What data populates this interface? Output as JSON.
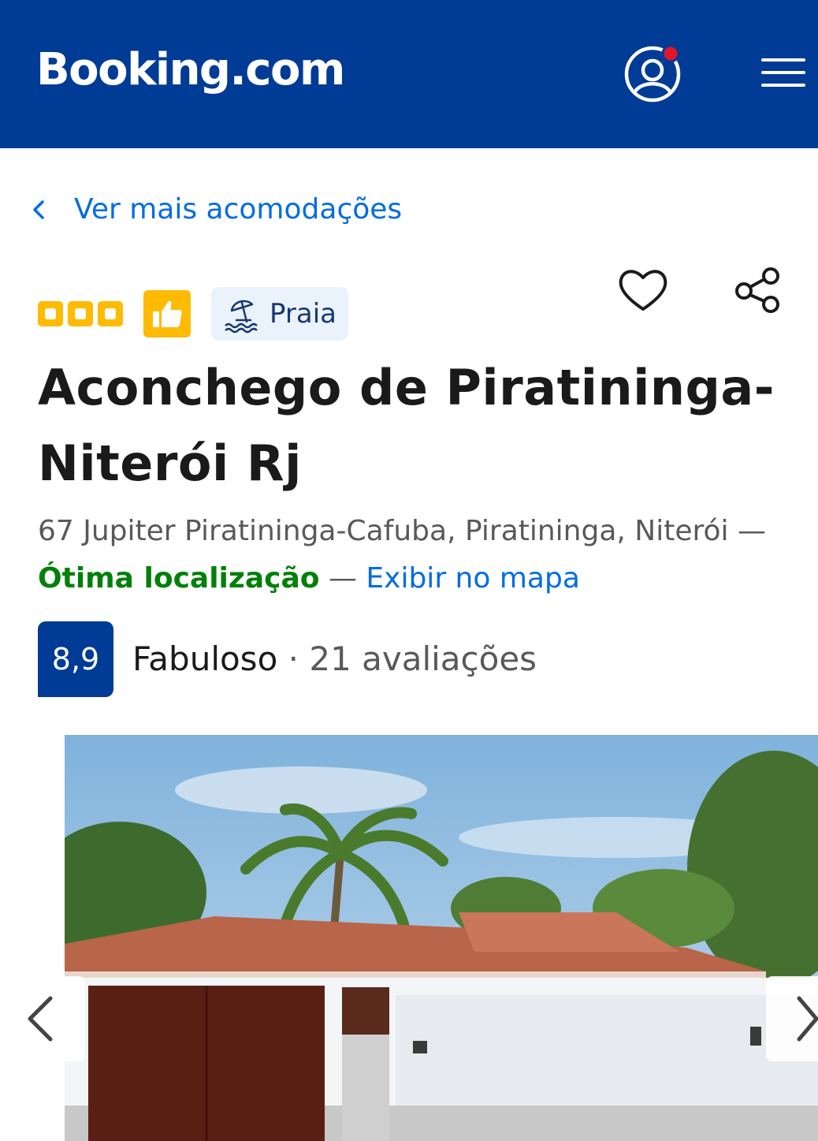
{
  "header": {
    "logo": "Booking.com",
    "account_icon": "account-icon",
    "menu_icon": "hamburger-menu-icon",
    "brand_color": "#003b95",
    "notification_color": "#e0162b"
  },
  "back_link": {
    "label": "Ver mais acomodações",
    "icon": "chevron-left-icon"
  },
  "property": {
    "rating_squares": 3,
    "preferred_icon": "thumbs-up-icon",
    "tag": {
      "label": "Praia",
      "icon": "beach-umbrella-icon"
    },
    "favorite_icon": "heart-icon",
    "share_icon": "share-icon",
    "name": "Aconchego de Piratininga-Niterói Rj",
    "address": "67 Jupiter Piratininga-Cafuba, Piratininga, Niterói —",
    "location_label": "Ótima localização",
    "separator": "—",
    "map_link": "Exibir no mapa"
  },
  "review": {
    "score": "8,9",
    "label": "Fabuloso",
    "dot": "·",
    "count": "21 avaliações"
  },
  "gallery": {
    "prev_icon": "chevron-left-icon",
    "next_icon": "chevron-right-icon",
    "photo_subject": "property-exterior-photo"
  },
  "colors": {
    "link": "#006ce4",
    "location": "#008009",
    "star": "#febb02"
  }
}
